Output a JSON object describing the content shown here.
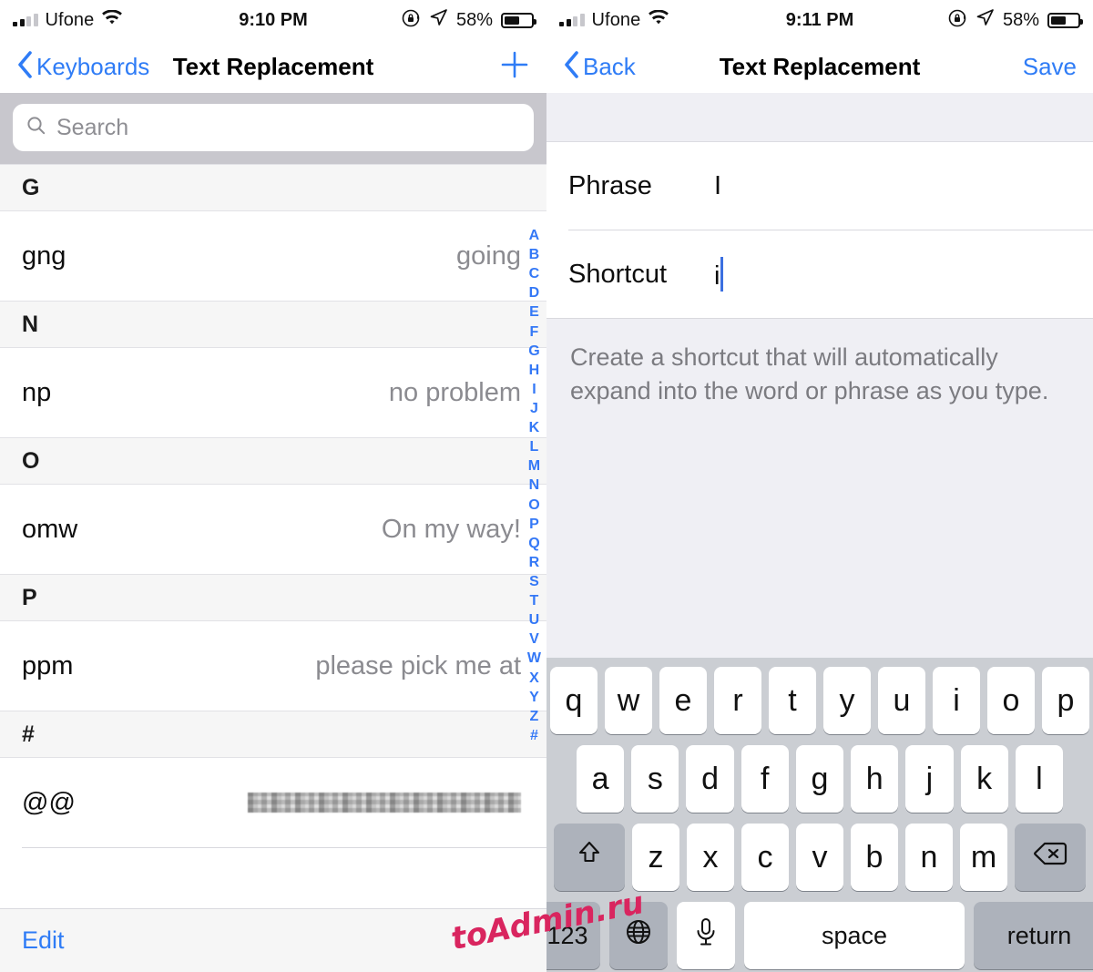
{
  "left": {
    "status_bar": {
      "carrier": "Ufone",
      "signal_icon": "cellular-bars-icon",
      "wifi_icon": "wifi-icon",
      "time": "9:10 PM",
      "rotation_lock_icon": "rotation-lock-icon",
      "location_icon": "location-arrow-icon",
      "battery_percent": "58%",
      "battery_level": 58
    },
    "nav": {
      "back_label": "Keyboards",
      "back_icon": "chevron-left-icon",
      "title": "Text Replacement",
      "add_icon": "plus-icon"
    },
    "search": {
      "placeholder": "Search",
      "icon": "search-icon",
      "value": ""
    },
    "sections": [
      {
        "header": "G",
        "rows": [
          {
            "shortcut": "gng",
            "phrase": "going",
            "redacted": false
          }
        ]
      },
      {
        "header": "N",
        "rows": [
          {
            "shortcut": "np",
            "phrase": "no problem",
            "redacted": false
          }
        ]
      },
      {
        "header": "O",
        "rows": [
          {
            "shortcut": "omw",
            "phrase": "On my way!",
            "redacted": false
          }
        ]
      },
      {
        "header": "P",
        "rows": [
          {
            "shortcut": "ppm",
            "phrase": "please pick me at",
            "redacted": false
          }
        ]
      },
      {
        "header": "#",
        "rows": [
          {
            "shortcut": "@@",
            "phrase": "",
            "redacted": true
          }
        ]
      }
    ],
    "index_bar": [
      "A",
      "B",
      "C",
      "D",
      "E",
      "F",
      "G",
      "H",
      "I",
      "J",
      "K",
      "L",
      "M",
      "N",
      "O",
      "P",
      "Q",
      "R",
      "S",
      "T",
      "U",
      "V",
      "W",
      "X",
      "Y",
      "Z",
      "#"
    ],
    "footer": {
      "edit_label": "Edit"
    }
  },
  "right": {
    "status_bar": {
      "carrier": "Ufone",
      "signal_icon": "cellular-bars-icon",
      "wifi_icon": "wifi-icon",
      "time": "9:11 PM",
      "rotation_lock_icon": "rotation-lock-icon",
      "location_icon": "location-arrow-icon",
      "battery_percent": "58%",
      "battery_level": 58
    },
    "nav": {
      "back_label": "Back",
      "back_icon": "chevron-left-icon",
      "title": "Text Replacement",
      "save_label": "Save"
    },
    "form": {
      "phrase_label": "Phrase",
      "phrase_value": "I",
      "shortcut_label": "Shortcut",
      "shortcut_value": "i",
      "description": "Create a shortcut that will automatically expand into the word or phrase as you type."
    },
    "keyboard": {
      "row1": [
        "q",
        "w",
        "e",
        "r",
        "t",
        "y",
        "u",
        "i",
        "o",
        "p"
      ],
      "row2": [
        "a",
        "s",
        "d",
        "f",
        "g",
        "h",
        "j",
        "k",
        "l"
      ],
      "row3": [
        "z",
        "x",
        "c",
        "v",
        "b",
        "n",
        "m"
      ],
      "shift_icon": "shift-arrow-icon",
      "delete_icon": "backspace-delete-icon",
      "numbers_label": "123",
      "globe_icon": "globe-language-icon",
      "mic_icon": "microphone-icon",
      "space_label": "space",
      "return_label": "return"
    }
  },
  "watermark": {
    "text": "toAdmin.ru",
    "color": "#d9255f"
  },
  "colors": {
    "accent_blue": "#2f7cf6",
    "index_blue": "#3478f6",
    "search_bg": "#c8c7cd",
    "section_header_bg": "#f6f6f6",
    "panel_bg": "#efeff4",
    "keyboard_bg": "#cbced3",
    "key_dark": "#adb2bb",
    "secondary_text": "#8b8b90",
    "caret": "#3b6fe0"
  }
}
